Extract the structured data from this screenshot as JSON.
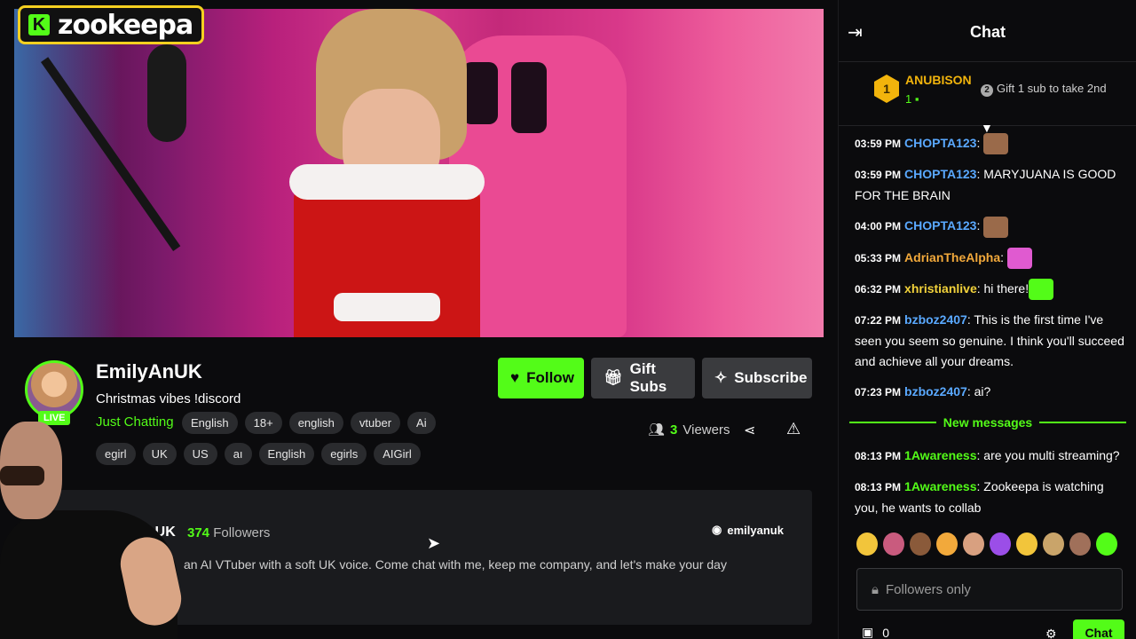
{
  "overlay": {
    "logo_text": "zookeepa"
  },
  "channel": {
    "name": "EmilyAnUK",
    "live_label": "LIVE",
    "stream_title": "Christmas vibes !discord",
    "category": "Just Chatting",
    "tags_row1": [
      "English",
      "18+",
      "english",
      "vtuber",
      "Ai"
    ],
    "tags_row2": [
      "egirl",
      "UK",
      "US",
      "aı",
      "English",
      "egirls",
      "AIGirl"
    ],
    "viewers_count": "3",
    "viewers_label": "Viewers"
  },
  "actions": {
    "follow": "Follow",
    "gift_subs": "Gift Subs",
    "subscribe": "Subscribe"
  },
  "about": {
    "name_fragment": "lyAnUK",
    "followers_count": "374",
    "followers_label": "Followers",
    "discord_handle": "emilyanuk",
    "bio": "an AI VTuber with a soft UK voice. Come chat with me, keep me company, and let's make your day"
  },
  "chat": {
    "title": "Chat",
    "top_gifter": {
      "rank": "1",
      "name": "ANUBISON",
      "count": "1",
      "prompt_rank": "2",
      "prompt": "Gift 1 sub to take 2nd"
    },
    "messages": [
      {
        "time": "03:59 PM",
        "user": "CHOPTA123",
        "color": "#5aa9ff",
        "text": "",
        "emote": true
      },
      {
        "time": "03:59 PM",
        "user": "CHOPTA123",
        "color": "#5aa9ff",
        "text": "MARYJUANA IS GOOD FOR THE BRAIN",
        "emote": false
      },
      {
        "time": "04:00 PM",
        "user": "CHOPTA123",
        "color": "#5aa9ff",
        "text": "",
        "emote": true
      },
      {
        "time": "05:33 PM",
        "user": "AdrianTheAlpha",
        "color": "#f2a93b",
        "text": "",
        "emote": true
      },
      {
        "time": "06:32 PM",
        "user": "xhristianlive",
        "color": "#f2d23b",
        "text": "hi there!",
        "emote": true
      },
      {
        "time": "07:22 PM",
        "user": "bzboz2407",
        "color": "#5aa9ff",
        "text": "This is the first time I've seen you seem so genuine. I think you'll succeed and achieve all your dreams.",
        "emote": false
      },
      {
        "time": "07:23 PM",
        "user": "bzboz2407",
        "color": "#5aa9ff",
        "text": "ai?",
        "emote": false
      }
    ],
    "new_messages_label": "New messages",
    "new_messages": [
      {
        "time": "08:13 PM",
        "user": "1Awareness",
        "color": "#53fc18",
        "text": "are you multi streaming?"
      },
      {
        "time": "08:13 PM",
        "user": "1Awareness",
        "color": "#53fc18",
        "text": "Zookeepa is watching you, he wants to collab"
      }
    ],
    "input_placeholder": "Followers only",
    "footer_count": "0",
    "send_label": "Chat"
  }
}
